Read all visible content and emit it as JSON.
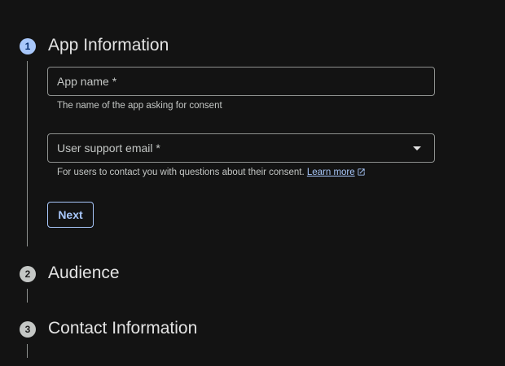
{
  "steps": [
    {
      "number": "1",
      "title": "App Information",
      "state": "active"
    },
    {
      "number": "2",
      "title": "Audience",
      "state": "inactive"
    },
    {
      "number": "3",
      "title": "Contact Information",
      "state": "inactive"
    }
  ],
  "app_info": {
    "app_name": {
      "label": "App name *",
      "value": "",
      "helper": "The name of the app asking for consent"
    },
    "support_email": {
      "label": "User support email *",
      "selected": "",
      "helper": "For users to contact you with questions about their consent.",
      "link_text": "Learn more",
      "link_icon": "open-in-new-icon"
    },
    "next_label": "Next"
  },
  "colors": {
    "background": "#131313",
    "accent": "#a8c7fa",
    "outline": "#8e918f",
    "text_primary": "#e3e3e3",
    "text_secondary": "#c4c7c5"
  }
}
